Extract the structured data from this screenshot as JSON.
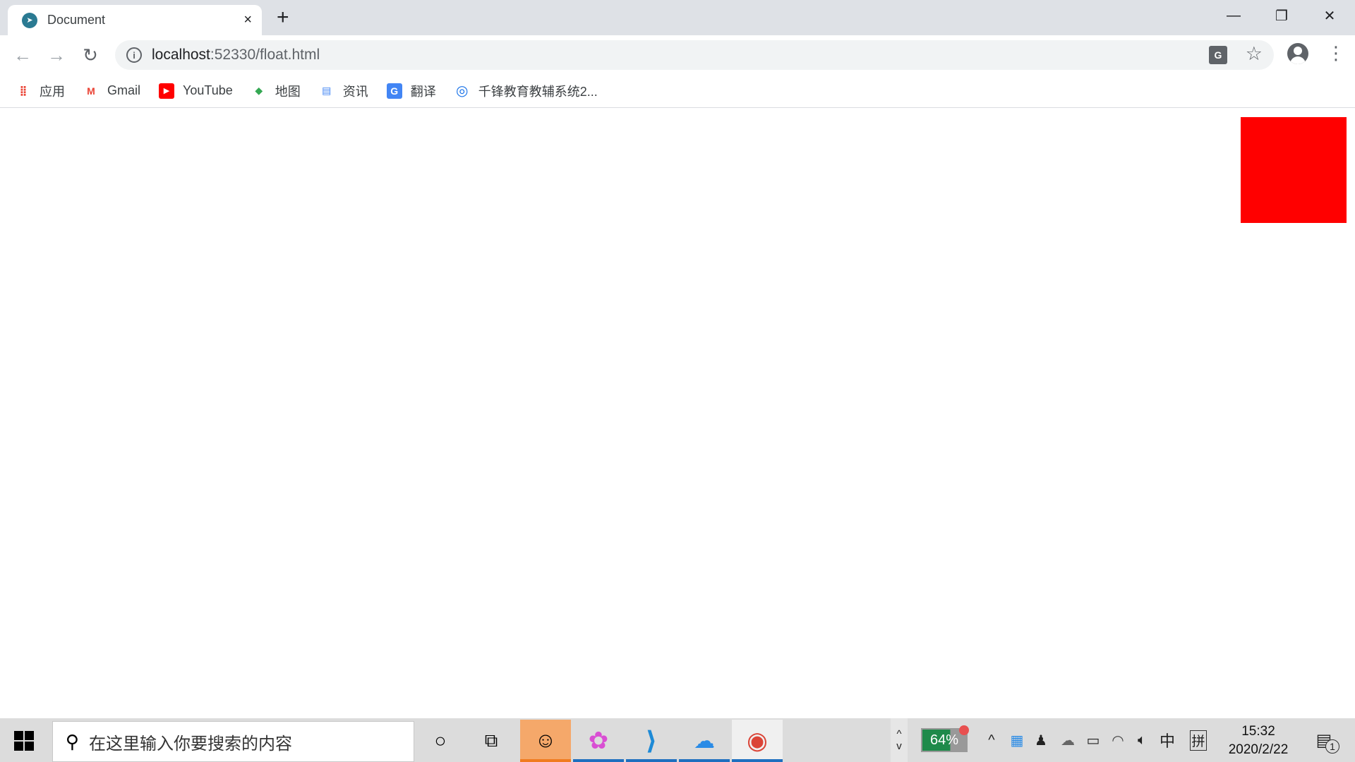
{
  "browser": {
    "tab": {
      "title": "Document",
      "close_icon": "×",
      "favicon": "➤"
    },
    "new_tab_icon": "+",
    "window_controls": {
      "minimize": "—",
      "restore": "❐",
      "close": "✕"
    },
    "nav": {
      "back": "←",
      "forward": "→",
      "reload": "↻"
    },
    "address": {
      "host": "localhost",
      "rest": ":52330/float.html",
      "info_icon": "i"
    },
    "omnibox_icons": {
      "translate": "G",
      "bookmark": "☆"
    },
    "menu_icon": "⋮",
    "bookmarks": [
      {
        "label": "应用",
        "icon": "apps-grid-icon",
        "glyph": "⣿",
        "color": "#4285f4"
      },
      {
        "label": "Gmail",
        "icon": "gmail-icon",
        "glyph": "M",
        "color": "#ea4335"
      },
      {
        "label": "YouTube",
        "icon": "youtube-icon",
        "glyph": "▶",
        "color": "#ff0000"
      },
      {
        "label": "地图",
        "icon": "maps-icon",
        "glyph": "◆",
        "color": "#34a853"
      },
      {
        "label": "资讯",
        "icon": "news-icon",
        "glyph": "▤",
        "color": "#4285f4"
      },
      {
        "label": "翻译",
        "icon": "translate-icon",
        "glyph": "G",
        "color": "#4285f4"
      },
      {
        "label": "千锋教育教辅系统2...",
        "icon": "qianfeng-icon",
        "glyph": "◎",
        "color": "#1a73e8"
      }
    ]
  },
  "page": {
    "float_box": {
      "color": "#ff0000",
      "float": "right"
    }
  },
  "taskbar": {
    "search_placeholder": "在这里输入你要搜索的内容",
    "cortana_icon": "○",
    "task_view_icon": "⧉",
    "apps": [
      {
        "name": "avatar-app",
        "glyph": "☺",
        "active": true
      },
      {
        "name": "clover-app",
        "glyph": "✿"
      },
      {
        "name": "vscode",
        "glyph": "⟩"
      },
      {
        "name": "baidu-netdisk",
        "glyph": "☁"
      },
      {
        "name": "chrome",
        "glyph": "◉"
      }
    ],
    "scroll_up": "^",
    "scroll_down": "v",
    "battery_percent": "64%",
    "tray": {
      "chevron": "^",
      "ime_lang": "中",
      "ime_mode": "拼"
    },
    "clock": {
      "time": "15:32",
      "date": "2020/2/22"
    },
    "notification_count": "1"
  }
}
